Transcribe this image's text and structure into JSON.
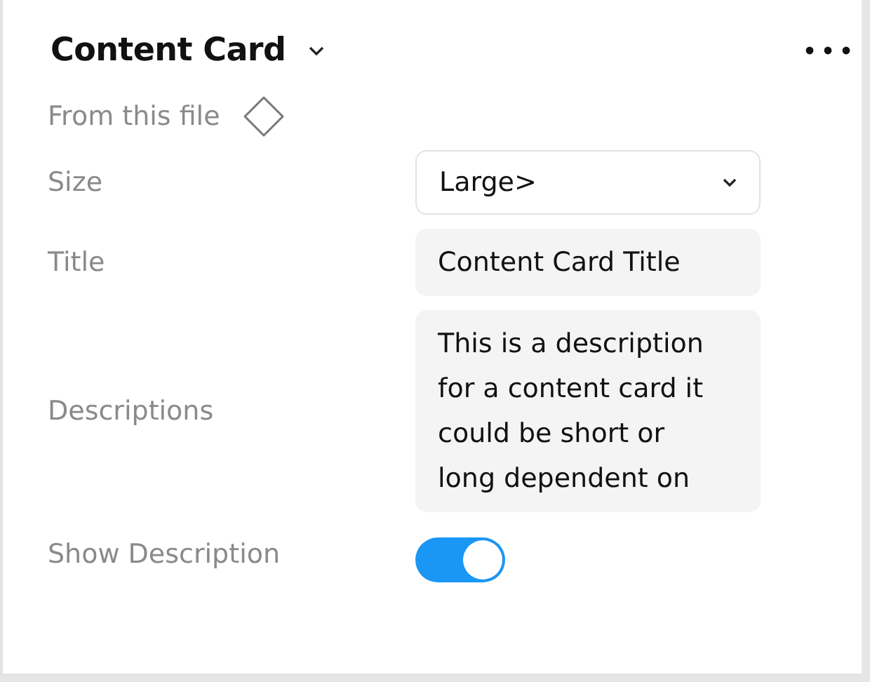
{
  "header": {
    "title": "Content Card"
  },
  "source": {
    "text": "From this file"
  },
  "properties": [
    {
      "kind": "select",
      "label": "Size",
      "value": "Large>"
    },
    {
      "kind": "text",
      "label": "Title",
      "value": "Content Card Title"
    },
    {
      "kind": "textarea",
      "label": "Descriptions",
      "value": "This is a description for a content card it could be short or long dependent on"
    },
    {
      "kind": "toggle",
      "label": "Show Description",
      "on": true
    }
  ]
}
